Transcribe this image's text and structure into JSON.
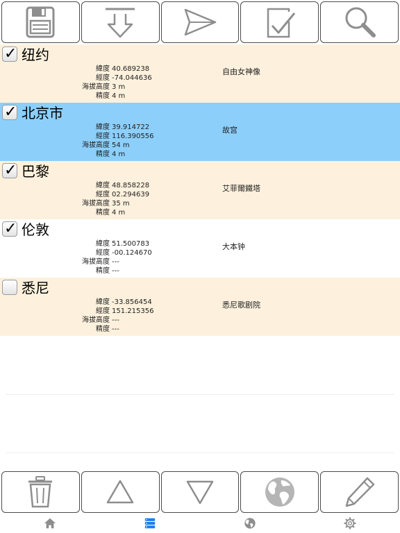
{
  "top_toolbar": {
    "buttons": [
      {
        "icon": "save-icon"
      },
      {
        "icon": "download-icon"
      },
      {
        "icon": "send-icon"
      },
      {
        "icon": "check-document-icon"
      },
      {
        "icon": "search-icon"
      }
    ]
  },
  "locations": [
    {
      "city": "纽约",
      "checked": true,
      "lat_label": "緯度",
      "lat": "40.689238",
      "lon_label": "經度",
      "lon": "-74.044636",
      "alt_label": "海拔高度",
      "alt": "3 m",
      "acc_label": "精度",
      "acc": "4 m",
      "landmark": "自由女神像"
    },
    {
      "city": "北京市",
      "checked": true,
      "lat_label": "緯度",
      "lat": "39.914722",
      "lon_label": "經度",
      "lon": "116.390556",
      "alt_label": "海拔高度",
      "alt": "54 m",
      "acc_label": "精度",
      "acc": "4 m",
      "landmark": "故宫"
    },
    {
      "city": "巴黎",
      "checked": true,
      "lat_label": "緯度",
      "lat": "48.858228",
      "lon_label": "經度",
      "lon": "02.294639",
      "alt_label": "海拔高度",
      "alt": "35 m",
      "acc_label": "精度",
      "acc": "4 m",
      "landmark": "艾菲爾鐵塔"
    },
    {
      "city": "伦敦",
      "checked": true,
      "lat_label": "緯度",
      "lat": "51.500783",
      "lon_label": "經度",
      "lon": "-00.124670",
      "alt_label": "海拔高度",
      "alt": "---",
      "acc_label": "精度",
      "acc": "---",
      "landmark": "大本钟"
    },
    {
      "city": "悉尼",
      "checked": false,
      "lat_label": "緯度",
      "lat": "-33.856454",
      "lon_label": "經度",
      "lon": "151.215356",
      "alt_label": "海拔高度",
      "alt": "---",
      "acc_label": "精度",
      "acc": "---",
      "landmark": "悉尼歌剧院"
    }
  ],
  "check_mark": "✓",
  "bottom_toolbar": {
    "buttons": [
      {
        "icon": "trash-icon"
      },
      {
        "icon": "move-up-icon"
      },
      {
        "icon": "move-down-icon"
      },
      {
        "icon": "globe-icon"
      },
      {
        "icon": "edit-pencil-icon"
      }
    ]
  },
  "tabs": [
    {
      "icon": "home-icon",
      "active": false
    },
    {
      "icon": "list-icon",
      "active": true
    },
    {
      "icon": "globe-tab-icon",
      "active": false
    },
    {
      "icon": "settings-gear-icon",
      "active": false
    }
  ],
  "colors": {
    "row_cream": "#fdf1dd",
    "row_selected": "#8ccffb",
    "icon_gray": "#9a9a9a",
    "tab_active": "#1a7ef0",
    "tab_inactive": "#8e8e8e"
  }
}
